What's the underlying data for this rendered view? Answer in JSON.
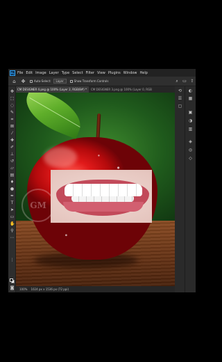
{
  "app": {
    "logo_text": "Ps"
  },
  "menu": {
    "items": [
      "File",
      "Edit",
      "Image",
      "Layer",
      "Type",
      "Select",
      "Filter",
      "View",
      "Plugins",
      "Window",
      "Help"
    ]
  },
  "options_bar": {
    "auto_select_label": "Auto-Select:",
    "auto_select_value": "Layer",
    "show_transform_label": "Show Transform Controls"
  },
  "tabs": [
    {
      "label": "CM DESIGNER 4.png @ 100% (Layer 2, RGB/8#) *",
      "active": true
    },
    {
      "label": "CM DESIGNER 3.png @ 100% (Layer 0, RGB",
      "active": false
    }
  ],
  "canvas": {
    "watermark_text": "GM"
  },
  "status": {
    "zoom": "100%",
    "doc_size": "1024 px x 1536 px (72 ppi)"
  },
  "icons": {
    "toolbar": [
      "move-icon",
      "marquee-icon",
      "lasso-icon",
      "quick-select-icon",
      "crop-icon",
      "frame-icon",
      "eyedropper-icon",
      "healing-icon",
      "brush-icon",
      "stamp-icon",
      "history-brush-icon",
      "eraser-icon",
      "gradient-icon",
      "blur-icon",
      "dodge-icon",
      "pen-icon",
      "type-icon",
      "path-select-icon",
      "shape-icon",
      "hand-icon",
      "zoom-icon",
      "more-tools-icon"
    ]
  },
  "colors": {
    "foreground": "#000000",
    "background": "#ffffff",
    "accent": "#31a8ff"
  }
}
